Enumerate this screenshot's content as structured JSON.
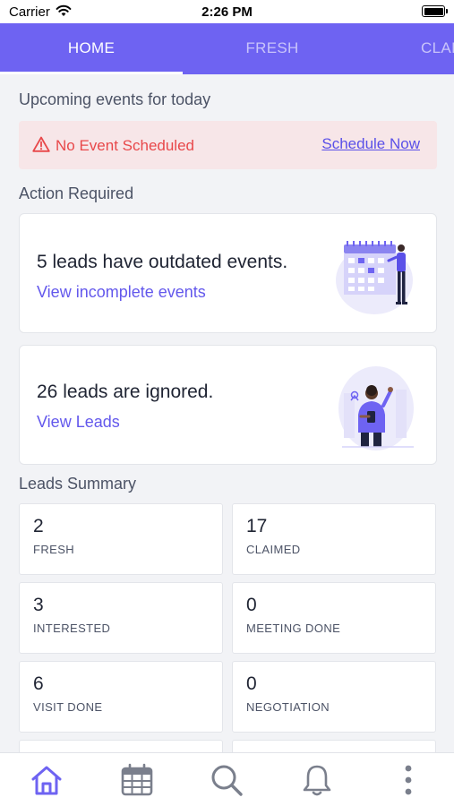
{
  "status_bar": {
    "carrier": "Carrier",
    "time": "2:26 PM"
  },
  "tabs": [
    {
      "label": "HOME",
      "active": true
    },
    {
      "label": "FRESH",
      "active": false
    },
    {
      "label": "CLAI",
      "active": false
    }
  ],
  "upcoming": {
    "title": "Upcoming events for today",
    "alert_text": "No Event Scheduled",
    "alert_link": "Schedule Now"
  },
  "action": {
    "title": "Action Required",
    "cards": [
      {
        "title": "5 leads have outdated events.",
        "link": "View incomplete events",
        "illustration": "calendar-person-illustration"
      },
      {
        "title": "26 leads are ignored.",
        "link": "View Leads",
        "illustration": "person-phone-illustration"
      }
    ]
  },
  "summary": {
    "title": "Leads Summary",
    "tiles": [
      {
        "value": "2",
        "label": "FRESH"
      },
      {
        "value": "17",
        "label": "CLAIMED"
      },
      {
        "value": "3",
        "label": "INTERESTED"
      },
      {
        "value": "0",
        "label": "MEETING DONE"
      },
      {
        "value": "6",
        "label": "VISIT DONE"
      },
      {
        "value": "0",
        "label": "NEGOTIATION"
      }
    ]
  },
  "bottom_nav": [
    "home-icon",
    "calendar-icon",
    "search-icon",
    "bell-icon",
    "more-icon"
  ],
  "colors": {
    "primary": "#6e63f2",
    "alert_bg": "#f7e6e8",
    "alert_text": "#e8484a",
    "link": "#6358ec",
    "background": "#f2f3f6"
  }
}
